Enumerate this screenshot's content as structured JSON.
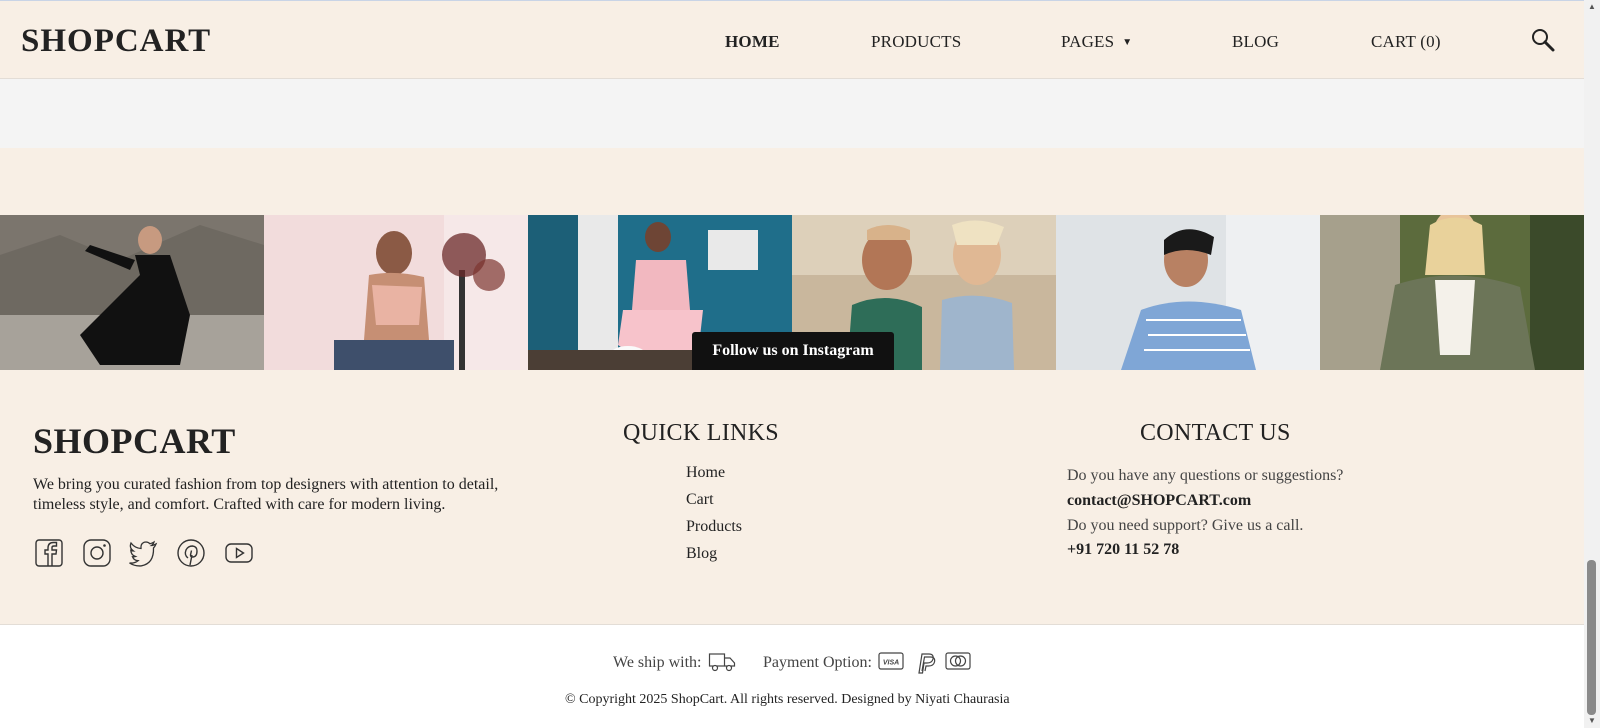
{
  "header": {
    "logo": "SHOPCART",
    "nav": {
      "home": "HOME",
      "products": "PRODUCTS",
      "pages": "PAGES",
      "blog": "BLOG",
      "cart": "CART (0)"
    },
    "search_icon": "search-icon"
  },
  "instagram": {
    "button_label": "Follow us on Instagram"
  },
  "footer": {
    "logo": "SHOPCART",
    "description": "We bring you curated fashion from top designers with attention to detail, timeless style, and comfort. Crafted with care for modern living.",
    "social_icons": [
      "facebook-icon",
      "instagram-icon",
      "twitter-icon",
      "pinterest-icon",
      "youtube-icon"
    ],
    "quick_links": {
      "title": "QUICK LINKS",
      "items": [
        "Home",
        "Cart",
        "Products",
        "Blog"
      ]
    },
    "contact": {
      "title": "CONTACT US",
      "question": "Do you have any questions or suggestions?",
      "email": "contact@SHOPCART.com",
      "support": "Do you need support? Give us a call.",
      "phone": "+91 720 11 52 78"
    }
  },
  "bottom_bar": {
    "ship_label": "We ship with:",
    "payment_label": "Payment Option:",
    "copyright": "© Copyright 2025 ShopCart. All rights reserved. Designed by",
    "designer": "Niyati Chaurasia"
  },
  "colors": {
    "beige": "#f8efe5",
    "grey": "#f4f4f4",
    "dark": "#111111"
  }
}
